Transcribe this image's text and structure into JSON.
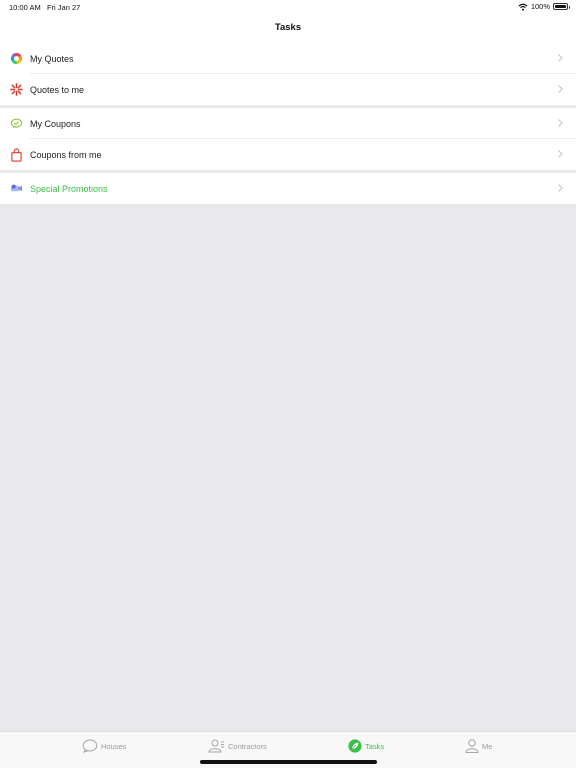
{
  "status": {
    "time": "10:00 AM",
    "date": "Fri Jan 27",
    "battery": "100%",
    "battery_level": 1.0
  },
  "nav": {
    "title": "Tasks"
  },
  "groups": [
    {
      "items": [
        {
          "label": "My Quotes",
          "icon": "color-wheel-icon"
        },
        {
          "label": "Quotes to me",
          "icon": "starburst-icon"
        }
      ]
    },
    {
      "items": [
        {
          "label": "My Coupons",
          "icon": "coupon-bubble-icon"
        },
        {
          "label": "Coupons from me",
          "icon": "shopping-bag-icon"
        }
      ]
    },
    {
      "items": [
        {
          "label": "Special Promotions",
          "icon": "promotion-icon"
        }
      ]
    }
  ],
  "tabs": [
    {
      "label": "Houses",
      "icon": "speech-bubble-icon",
      "active": false
    },
    {
      "label": "Contractors",
      "icon": "people-icon",
      "active": false
    },
    {
      "label": "Tasks",
      "icon": "leaf-icon",
      "active": true
    },
    {
      "label": "Me",
      "icon": "person-icon",
      "active": false
    }
  ],
  "colors": {
    "accent": "#3cbf4a",
    "background": "#e9e9eb",
    "text": "#1c1c1e",
    "inactive": "#9a9a9a"
  }
}
